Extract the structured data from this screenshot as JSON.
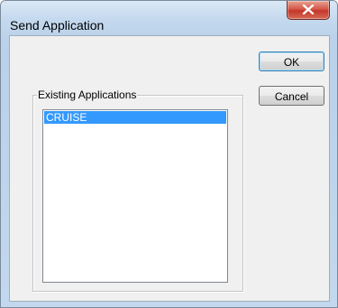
{
  "window": {
    "title": "Send Application",
    "close_icon": "close-icon"
  },
  "buttons": {
    "ok_label": "OK",
    "cancel_label": "Cancel"
  },
  "group": {
    "label": "Existing Applications"
  },
  "list": {
    "items": [
      {
        "label": "CRUISE",
        "selected": true
      }
    ]
  },
  "colors": {
    "selection": "#3399ff",
    "close_button": "#c4372a",
    "frame": "#bcd3ea"
  }
}
